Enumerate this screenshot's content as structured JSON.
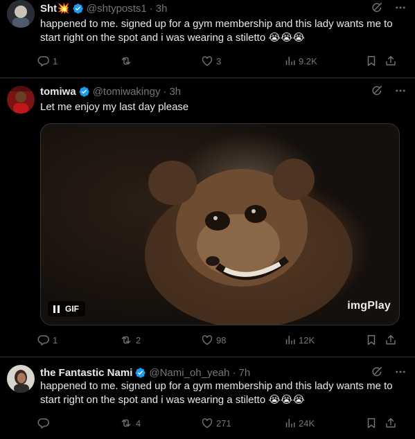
{
  "colors": {
    "background": "#000000",
    "text_primary": "#e7e9ea",
    "text_secondary": "#71767b",
    "verified_badge": "#1d9bf0",
    "divider": "#2f3336"
  },
  "tweets": [
    {
      "display_name": "Sht💥",
      "handle": "@shtyposts1",
      "separator": "·",
      "time": "3h",
      "verified": true,
      "text": "happened to me. signed up for a gym membership and this lady wants me to start right on the spot and i was wearing a stiletto 😭😭😭",
      "stats": {
        "replies": "1",
        "reposts": "",
        "likes": "3",
        "views": "9.2K"
      }
    },
    {
      "display_name": "tomiwa",
      "handle": "@tomiwakingy",
      "separator": "·",
      "time": "3h",
      "verified": true,
      "text": "Let me enjoy my last day please",
      "media": {
        "badge_label": "GIF",
        "watermark": "imgPlay",
        "state": "playing"
      },
      "stats": {
        "replies": "1",
        "reposts": "2",
        "likes": "98",
        "views": "12K"
      }
    },
    {
      "display_name": "the Fantastic Nami",
      "handle": "@Nami_oh_yeah",
      "separator": "·",
      "time": "7h",
      "verified": true,
      "text": "happened to me. signed up for a gym membership and this lady wants me to start right on the spot and i was wearing a stiletto 😭😭😭",
      "stats": {
        "replies": "",
        "reposts": "4",
        "likes": "271",
        "views": "24K"
      }
    }
  ]
}
